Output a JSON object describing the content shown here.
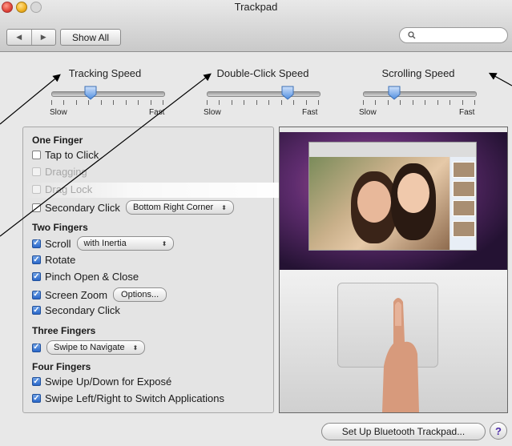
{
  "window": {
    "title": "Trackpad",
    "show_all_label": "Show All",
    "back_icon": "◀",
    "forward_icon": "▶",
    "search_icon": "🔍",
    "search_placeholder": ""
  },
  "sliders": [
    {
      "label": "Tracking Speed",
      "slow_label": "Slow",
      "fast_label": "Fast",
      "value": 0.33
    },
    {
      "label": "Double-Click Speed",
      "slow_label": "Slow",
      "fast_label": "Fast",
      "value": 0.75
    },
    {
      "label": "Scrolling Speed",
      "slow_label": "Slow",
      "fast_label": "Fast",
      "value": 0.25
    }
  ],
  "one_finger": {
    "heading": "One Finger",
    "tap_to_click": {
      "label": "Tap to Click",
      "checked": false
    },
    "dragging": {
      "label": "Dragging",
      "checked": false
    },
    "drag_lock": {
      "label": "Drag Lock",
      "checked": false
    },
    "secondary_click": {
      "label": "Secondary Click",
      "checked": false,
      "option": "Bottom Right Corner"
    }
  },
  "two_fingers": {
    "heading": "Two Fingers",
    "scroll": {
      "label": "Scroll",
      "checked": true,
      "option": "with Inertia"
    },
    "rotate": {
      "label": "Rotate",
      "checked": true
    },
    "pinch": {
      "label": "Pinch Open & Close",
      "checked": true
    },
    "screen_zoom": {
      "label": "Screen Zoom",
      "checked": true,
      "button": "Options..."
    },
    "secondary_click": {
      "label": "Secondary Click",
      "checked": true
    }
  },
  "three_fingers": {
    "heading": "Three Fingers",
    "swipe": {
      "checked": true,
      "option": "Swipe to Navigate"
    }
  },
  "four_fingers": {
    "heading": "Four Fingers",
    "swipe_updown": {
      "label": "Swipe Up/Down for Exposé",
      "checked": true
    },
    "swipe_leftright": {
      "label": "Swipe Left/Right to Switch Applications",
      "checked": true
    }
  },
  "footer": {
    "bluetooth_button": "Set Up Bluetooth Trackpad...",
    "help_label": "?"
  },
  "colors": {
    "accent": "#2a67c9",
    "help": "#4b2aa8"
  }
}
